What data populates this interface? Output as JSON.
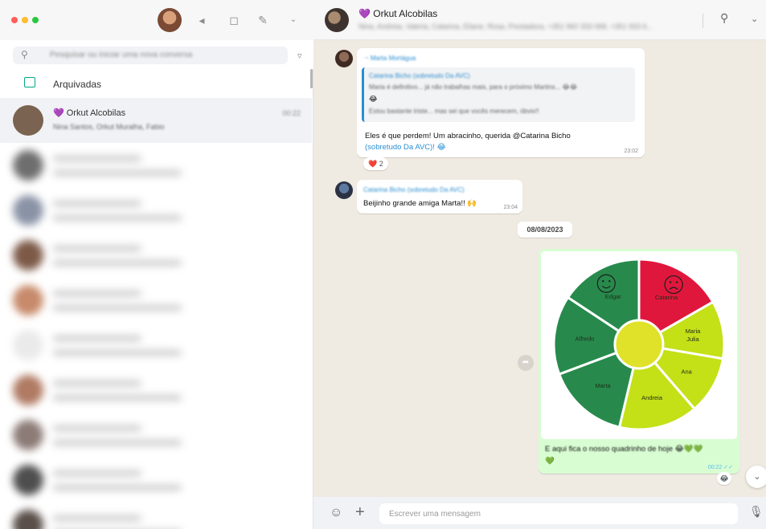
{
  "left": {
    "search_placeholder": "Pesquisar ou iniciar uma nova conversa",
    "archived_label": "Arquivadas",
    "chats": [
      {
        "name": "💜 Orkut Alcobilas",
        "preview": "Nina Santos, Orkut Muralha, Fabio",
        "time": "00:22",
        "active": true,
        "avatar": "#7a6350"
      },
      {
        "name": "",
        "preview": "",
        "time": "",
        "active": false,
        "avatar": "#6e6e6e"
      },
      {
        "name": "",
        "preview": "",
        "time": "",
        "active": false,
        "avatar": "#8a93a6"
      },
      {
        "name": "",
        "preview": "",
        "time": "",
        "active": false,
        "avatar": "#7d5a48"
      },
      {
        "name": "",
        "preview": "",
        "time": "",
        "active": false,
        "avatar": "#c78a6a"
      },
      {
        "name": "",
        "preview": "",
        "time": "",
        "active": false,
        "avatar": "#eaeaea"
      },
      {
        "name": "",
        "preview": "",
        "time": "",
        "active": false,
        "avatar": "#b07a63"
      },
      {
        "name": "",
        "preview": "",
        "time": "",
        "active": false,
        "avatar": "#8c7b76"
      },
      {
        "name": "",
        "preview": "",
        "time": "",
        "active": false,
        "avatar": "#4e4e4e"
      },
      {
        "name": "",
        "preview": "",
        "time": "",
        "active": false,
        "avatar": "#5a4f4a"
      }
    ]
  },
  "header": {
    "group_name": "💜 Orkut Alcobilas",
    "members": "Nina, Andreia, Valeria, Catarina, Eliane, Rosa, Prestadora, +351 960 333 068, +351 933 6..."
  },
  "messages": {
    "m1": {
      "sender": "~ Marta Mortágua",
      "quote_sender": "Catarina Bicho (sobretudo Da AVC)",
      "quote_line1": "Maria é definitivo... já não trabalhas mais, para o próximo Martins... 😂😂",
      "quote_line2": "😂",
      "quote_line3": "Estou bastante triste... mas sei que vocês merecem, óbvio!!",
      "text_line1": "Eles é que perdem! Um abracinho, querida @Catarina Bicho",
      "text_line2": "(sobretudo Da AVC)! 😂",
      "time": "23:02"
    },
    "reaction1": "❤️ 2",
    "m2": {
      "sender": "Catarina Bicho (sobretudo Da AVC)",
      "text": "Beijinho grande amiga Marta!! 🙌",
      "time": "23:04"
    },
    "date_chip": "08/08/2023",
    "m3": {
      "caption_line1": "E aqui fica o nosso quadrinho de hoje 😂💚💚",
      "caption_line2": "💚",
      "time": "00:22 ✓✓",
      "reaction": "😂"
    }
  },
  "composer": {
    "placeholder": "Escrever uma mensagem"
  },
  "colors": {
    "dark_green": "#278a4c",
    "red": "#e0173c",
    "lime": "#c4e017",
    "center": "#dfe228"
  },
  "chart_data": {
    "type": "pie",
    "title": "",
    "center_disc": true,
    "segments": [
      {
        "label": "Catarina",
        "share": 0.167,
        "color": "#e0173c",
        "icon": "sad-face"
      },
      {
        "label": "Maria Julia",
        "share": 0.11,
        "color": "#c4e017"
      },
      {
        "label": "Ana",
        "share": 0.11,
        "color": "#c4e017"
      },
      {
        "label": "Andreia",
        "share": 0.15,
        "color": "#c4e017"
      },
      {
        "label": "Marta",
        "share": 0.156,
        "color": "#278a4c"
      },
      {
        "label": "Alfredo",
        "share": 0.15,
        "color": "#278a4c"
      },
      {
        "label": "Edgar",
        "share": 0.157,
        "color": "#278a4c",
        "icon": "happy-face"
      }
    ]
  }
}
